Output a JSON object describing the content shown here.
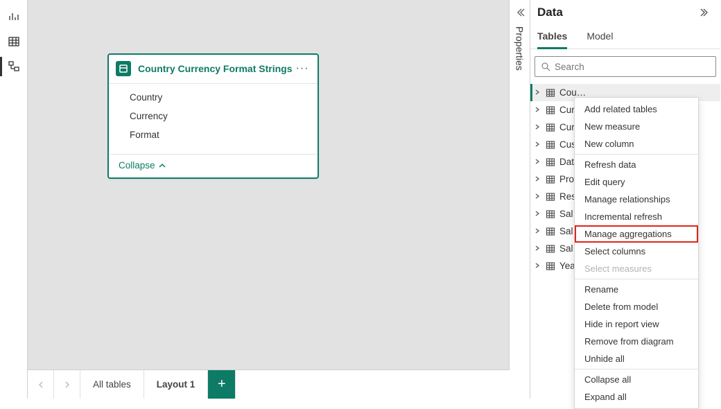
{
  "rail": {
    "items": [
      "report-view-icon",
      "data-view-icon",
      "model-view-icon"
    ],
    "activeIndex": 2
  },
  "card": {
    "title": "Country Currency Format Strings",
    "fields": [
      "Country",
      "Currency",
      "Format"
    ],
    "footer_label": "Collapse"
  },
  "tabstrip": {
    "tabs": [
      "All tables",
      "Layout 1"
    ],
    "activeIndex": 1,
    "add_label": "+"
  },
  "properties": {
    "label": "Properties"
  },
  "data_panel": {
    "title": "Data",
    "tabs": [
      "Tables",
      "Model"
    ],
    "activeTabIndex": 0,
    "search_placeholder": "Search",
    "tables": [
      "Cou",
      "Cur",
      "Cur",
      "Cus",
      "Dat",
      "Pro",
      "Res",
      "Sal",
      "Sal",
      "Sal",
      "Yea"
    ],
    "selectedIndex": 0
  },
  "context_menu": {
    "items": [
      {
        "label": "Add related tables"
      },
      {
        "label": "New measure"
      },
      {
        "label": "New column"
      },
      {
        "sep": true
      },
      {
        "label": "Refresh data"
      },
      {
        "label": "Edit query"
      },
      {
        "label": "Manage relationships"
      },
      {
        "label": "Incremental refresh"
      },
      {
        "label": "Manage aggregations",
        "highlight": true
      },
      {
        "label": "Select columns"
      },
      {
        "label": "Select measures",
        "disabled": true
      },
      {
        "sep": true
      },
      {
        "label": "Rename"
      },
      {
        "label": "Delete from model"
      },
      {
        "label": "Hide in report view"
      },
      {
        "label": "Remove from diagram"
      },
      {
        "label": "Unhide all"
      },
      {
        "sep": true
      },
      {
        "label": "Collapse all"
      },
      {
        "label": "Expand all"
      }
    ]
  }
}
